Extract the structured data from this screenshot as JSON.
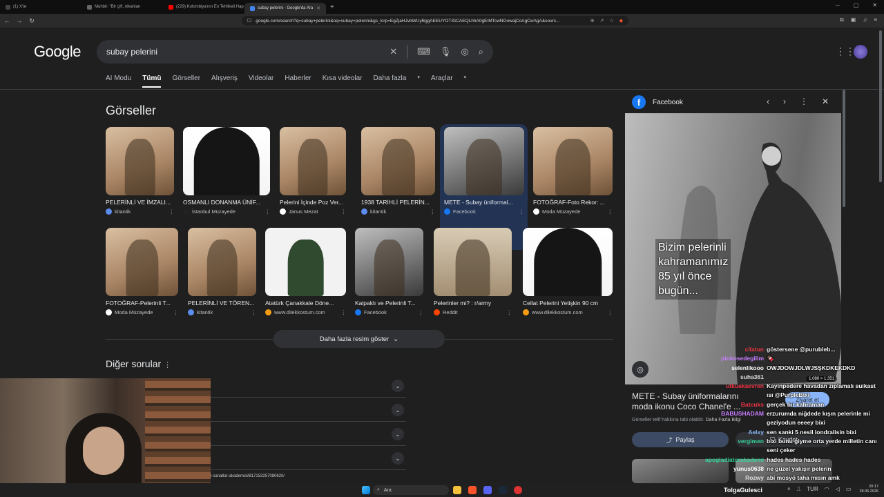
{
  "browser": {
    "tabs": [
      {
        "title": "(1) X'te ",
        "active": false,
        "color": "#444"
      },
      {
        "title": "Muhbir: \"Bir çift, nikahları",
        "active": false,
        "color": "#666"
      },
      {
        "title": "(229) Kolombiya'nın En Tehlikeli Hap",
        "active": false,
        "color": "#ff0000"
      },
      {
        "title": "subay pelerini - Google'da Ara",
        "active": true,
        "color": "#4285f4"
      }
    ],
    "url": "google.com/search?q=subay+pelerini&oq=subay+pelerini&gs_lcrp=EgZjaHJvbWUyBggAEEUYOTIGCAEQLhhA0gEIMTcwNGowajCoAgCwAgA&sourc..."
  },
  "google": {
    "logo": "Google",
    "query": "subay pelerini",
    "nav_tabs": [
      "AI Modu",
      "Tümü",
      "Görseller",
      "Alışveriş",
      "Videolar",
      "Haberler",
      "Kısa videolar",
      "Daha fazla",
      "Araçlar"
    ],
    "images_heading": "Görseller",
    "images_row1": [
      {
        "caption": "PELERİNLİ VE İMZALI...",
        "source": "kitantik",
        "src_color": "#5b8def"
      },
      {
        "caption": "OSMANLI DONANMA ÜNİF...",
        "source": "İstanbul Müzayede",
        "src_color": "#222"
      },
      {
        "caption": "Pelerini İçinde Poz Ver...",
        "source": "Janus Mezat",
        "src_color": "#fff"
      },
      {
        "caption": "1938 TARİHLİ PELERİN...",
        "source": "kitantik",
        "src_color": "#5b8def"
      },
      {
        "caption": "METE - Subay üniformal...",
        "source": "Facebook",
        "src_color": "#1877f2"
      },
      {
        "caption": "FOTOĞRAF-Foto Rekor: ...",
        "source": "Moda Müzayede",
        "src_color": "#fff"
      }
    ],
    "images_row2": [
      {
        "caption": "FOTOĞRAF-Pelerinli T...",
        "source": "Moda Müzayede",
        "src_color": "#fff"
      },
      {
        "caption": "PELERİNLİ VE TÖREN...",
        "source": "kitantik",
        "src_color": "#5b8def"
      },
      {
        "caption": "Atatürk Çanakkale Döne...",
        "source": "www.dilekkostum.com",
        "src_color": "#f39c12"
      },
      {
        "caption": "Kalpaklı ve Pelerinli T...",
        "source": "Facebook",
        "src_color": "#1877f2"
      },
      {
        "caption": "Pelerinler mi? : r/army",
        "source": "Reddit",
        "src_color": "#ff4500"
      },
      {
        "caption": "Cellat Pelerini Yetişkin 90 cm",
        "source": "www.dilekkostum.com",
        "src_color": "#f39c12"
      }
    ],
    "more_images": "Daha fazla resim göster",
    "other_questions": "Diğer sorular",
    "status_url": "l-sanatlar-akademisi/817153257080620/"
  },
  "preview": {
    "site": "Facebook",
    "overlay_text": "Bizim pelerinli\nkahramanımız\n85 yıl önce\nbugün...",
    "dimensions": "1.080 × 1.351",
    "title": "METE - Subay üniformalarını moda ikonu Coco Chanel'e ...",
    "visit": "Ziyaret et",
    "copyright": "Görseller telif hakkına tabi olabilir.",
    "more_info": "Daha Fazla Bilgi",
    "share": "Paylaş",
    "save": "Kaydet"
  },
  "chat": [
    {
      "user": "cilatun",
      "color": "#e34",
      "msg": "göstersene @purubleb..."
    },
    {
      "user": "pinkosedegilim",
      "color": "#c77dff",
      "msg": "🍫"
    },
    {
      "user": "selenlikooo",
      "color": "#fff",
      "msg": "OWJDOWJDLWJSŞKDKEKDKD"
    },
    {
      "user": "suha361",
      "color": "#ddd",
      "msg": ""
    },
    {
      "user": "utkuakaevren",
      "color": "#e34",
      "msg": "Kayinpedere havadan zıplamalı suikast ısı @PurpleBixi"
    },
    {
      "user": "Batcuks",
      "color": "#e34",
      "msg": "gerçek bir kahraman"
    },
    {
      "user": "BABUSHADAM",
      "color": "#c77dff",
      "msg": "erzurumda niğdede kışın pelerinle mi geziyodun eeeey bixi"
    },
    {
      "user": "Aelxy",
      "color": "#8ab4f8",
      "msg": "sen sanki 5 nesil londralisin bixi"
    },
    {
      "user": "vergimen",
      "color": "#34d399",
      "msg": "bixi bunu giyme orta yerde milletin canı seni çeker"
    },
    {
      "user": "apogladiatorakademi",
      "color": "#34d399",
      "msg": "hades hades hades"
    },
    {
      "user": "yunus0638",
      "color": "#fff",
      "msg": "ne güzel yakışır pelerin"
    },
    {
      "user": "Rozwy",
      "color": "#ddd",
      "msg": "abi mosyö taha mısın amk"
    }
  ],
  "taskbar": {
    "search": "Ara",
    "streamer": "TolgaGulesci",
    "lang": "TUR",
    "time": "20:17",
    "date": "28.05.2026"
  }
}
